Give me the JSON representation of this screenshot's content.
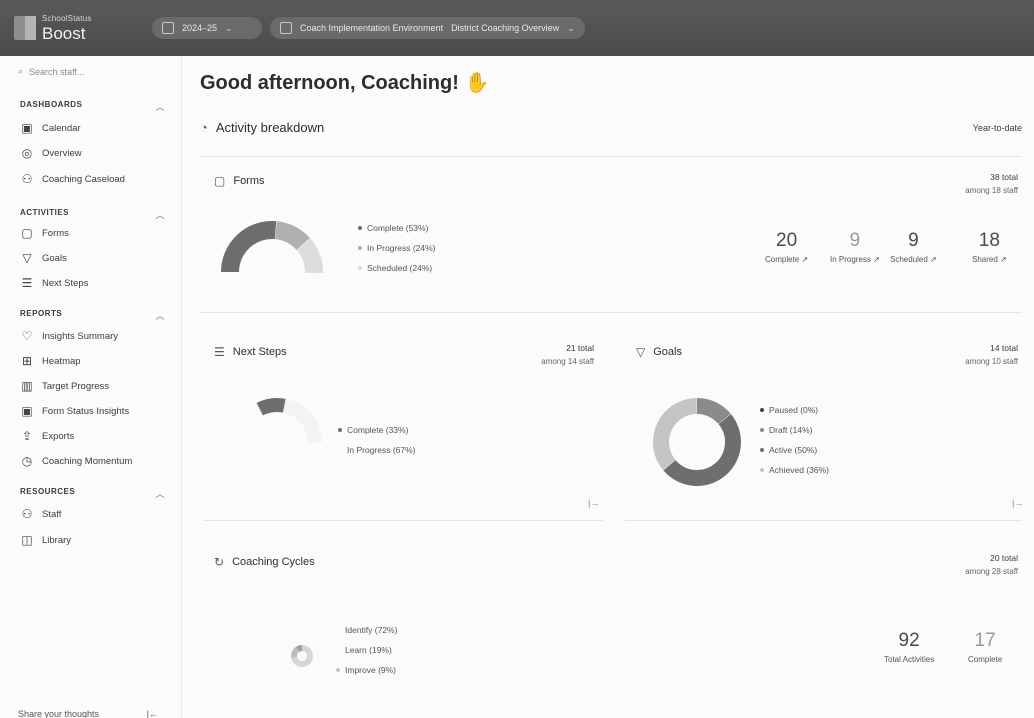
{
  "topbar": {
    "brand_top": "SchoolStatus",
    "brand_name": "Boost",
    "year": "2024–25",
    "environment": "Coach Implementation Environment",
    "view": "District Coaching Overview"
  },
  "sidebar": {
    "search_placeholder": "Search staff...",
    "dashboards": {
      "label": "DASHBOARDS",
      "items": [
        {
          "label": "Calendar",
          "icon": "calendar-icon"
        },
        {
          "label": "Overview",
          "icon": "compass-icon"
        },
        {
          "label": "Coaching Caseload",
          "icon": "people-icon"
        }
      ]
    },
    "activities": {
      "label": "ACTIVITIES",
      "items": [
        {
          "label": "Forms",
          "icon": "clipboard-icon"
        },
        {
          "label": "Goals",
          "icon": "funnel-icon"
        },
        {
          "label": "Next Steps",
          "icon": "list-icon"
        }
      ]
    },
    "reports": {
      "label": "REPORTS",
      "items": [
        {
          "label": "Insights Summary",
          "icon": "lightbulb-icon"
        },
        {
          "label": "Heatmap",
          "icon": "grid-icon"
        },
        {
          "label": "Target Progress",
          "icon": "bar-chart-icon"
        },
        {
          "label": "Form Status Insights",
          "icon": "clipboard-check-icon"
        },
        {
          "label": "Exports",
          "icon": "export-icon"
        },
        {
          "label": "Coaching Momentum",
          "icon": "clock-icon"
        }
      ]
    },
    "resources": {
      "label": "RESOURCES",
      "items": [
        {
          "label": "Staff",
          "icon": "staff-icon"
        },
        {
          "label": "Library",
          "icon": "book-icon"
        }
      ]
    },
    "share": "Share your thoughts",
    "collapse_icon": "collapse-icon"
  },
  "main": {
    "greeting": "Good afternoon, Coaching!",
    "activity_title": "Activity breakdown",
    "range": "Year-to-date",
    "forms": {
      "title": "Forms",
      "total": "38 total",
      "among": "among 18 staff",
      "legend": [
        "Complete (53%)",
        "In Progress (24%)",
        "Scheduled (24%)"
      ],
      "stats": [
        {
          "num": "20",
          "label": "Complete ↗"
        },
        {
          "num": "9",
          "label": "In Progress ↗"
        },
        {
          "num": "9",
          "label": "Scheduled ↗"
        },
        {
          "num": "18",
          "label": "Shared ↗"
        }
      ],
      "segments": [
        0.53,
        0.24,
        0.24
      ]
    },
    "next_steps": {
      "title": "Next Steps",
      "total": "21 total",
      "among": "among 14 staff",
      "legend": [
        "Complete (33%)",
        "In Progress (67%)"
      ],
      "segments": [
        0.33,
        0.67
      ]
    },
    "goals": {
      "title": "Goals",
      "total": "14 total",
      "among": "among 10 staff",
      "legend": [
        "Paused (0%)",
        "Draft (14%)",
        "Active (50%)",
        "Achieved (36%)"
      ],
      "segments": [
        0.0,
        0.14,
        0.5,
        0.36
      ]
    },
    "coaching_cycles": {
      "title": "Coaching Cycles",
      "total": "20 total",
      "among": "among 28 staff",
      "legend": [
        "Identify (72%)",
        "Learn (19%)",
        "Improve (9%)"
      ],
      "stats": [
        {
          "num": "92",
          "label": "Total Activities"
        },
        {
          "num": "17",
          "label": "Complete"
        }
      ],
      "segments": [
        0.72,
        0.19,
        0.09
      ]
    }
  },
  "colors": {
    "donut_dark": "#6e6e6e",
    "donut_mid": "#b0b0b0",
    "donut_light": "#dcdcdc"
  }
}
